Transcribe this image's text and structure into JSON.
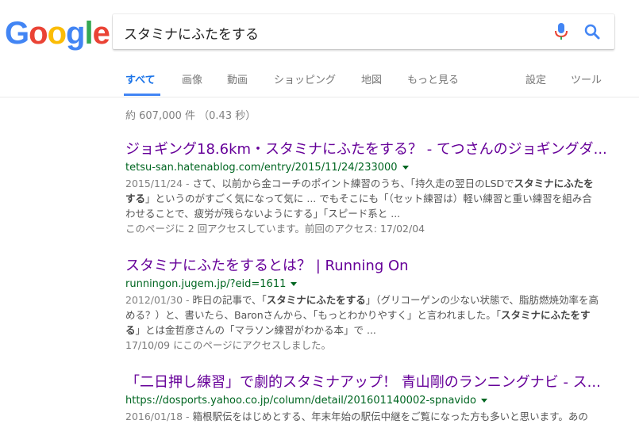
{
  "logo": {
    "text": [
      "G",
      "o",
      "o",
      "g",
      "l",
      "e"
    ],
    "colors": [
      "#4285f4",
      "#ea4335",
      "#fbbc05",
      "#4285f4",
      "#34a853",
      "#ea4335"
    ]
  },
  "search": {
    "query": "スタミナにふたをする"
  },
  "tabs": [
    {
      "label": "すべて",
      "active": true
    },
    {
      "label": "画像"
    },
    {
      "label": "動画"
    },
    {
      "label": "ショッピング"
    },
    {
      "label": "地図"
    },
    {
      "label": "もっと見る"
    }
  ],
  "tools": {
    "settings": "設定",
    "tools": "ツール"
  },
  "stats": "約 607,000 件 （0.43 秒）",
  "results": [
    {
      "title": "ジョギング18.6km・スタミナにふたをする？ - てつさんのジョギングダ...",
      "url": "tetsu-san.hatenablog.com/entry/2015/11/24/233000",
      "snippet": [
        {
          "t": "2015/11/24 - ",
          "cls": "r-date"
        },
        {
          "t": "さて、以前から金コーチのポイント練習のうち、「持久走の翌日のLSDで"
        },
        {
          "t": "スタミナにふたをする",
          "b": true
        },
        {
          "t": "」というのがすごく気になって気に ... でもそこにも「（セット練習は）軽い練習と重い練習を組み合わせることで、疲労が残らないようにする」「スピード系と ..."
        }
      ],
      "visited": "このページに 2 回アクセスしています。前回のアクセス: 17/02/04"
    },
    {
      "title": "スタミナにふたをするとは？ | Running On",
      "url": "runningon.jugem.jp/?eid=1611",
      "snippet": [
        {
          "t": "2012/01/30 - ",
          "cls": "r-date"
        },
        {
          "t": "昨日の記事で、「"
        },
        {
          "t": "スタミナにふたをする",
          "b": true
        },
        {
          "t": "」（グリコーゲンの少ない状態で、脂肪燃焼効率を高める？）と、書いたら、Baronさんから、「もっとわかりやすく」と言われました。「"
        },
        {
          "t": "スタミナにふたをする",
          "b": true
        },
        {
          "t": "」とは金哲彦さんの「マラソン練習がわかる本」で ..."
        }
      ],
      "visited": "17/10/09 にこのページにアクセスしました。"
    },
    {
      "title": "「二日押し練習」で劇的スタミナアップ！ 青山剛のランニングナビ - ス...",
      "url": "https://dosports.yahoo.co.jp/column/detail/201601140002-spnavido",
      "snippet": [
        {
          "t": "2016/01/18 - ",
          "cls": "r-date"
        },
        {
          "t": "箱根駅伝をはじめとする、年末年始の駅伝中継をご覧になった方も多いと思います。あの"
        }
      ],
      "visited": ""
    }
  ]
}
